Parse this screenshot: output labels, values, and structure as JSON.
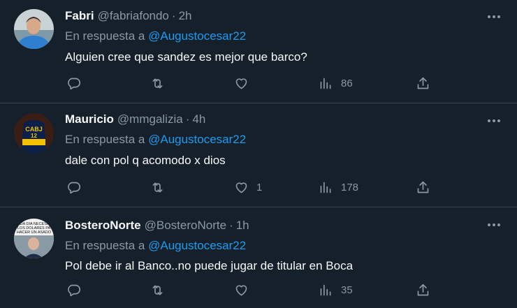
{
  "tweets": [
    {
      "name": "Fabri",
      "handle": "@fabriafondo",
      "separator": "·",
      "time": "2h",
      "reply_prefix": "En respuesta a",
      "reply_user": "@Augustocesar22",
      "text": "Alguien cree que sandez es mejor que barco?",
      "likes": "",
      "views": "86"
    },
    {
      "name": "Mauricio",
      "handle": "@mmgalizia",
      "separator": "·",
      "time": "4h",
      "reply_prefix": "En respuesta a",
      "reply_user": "@Augustocesar22",
      "text": "dale con pol q acomodo x dios",
      "likes": "1",
      "views": "178"
    },
    {
      "name": "BosteroNorte",
      "handle": "@BosteroNorte",
      "separator": "·",
      "time": "1h",
      "reply_prefix": "En respuesta a",
      "reply_user": "@Augustocesar22",
      "text": "Pol debe ir al Banco..no puede jugar de titular en Boca",
      "likes": "",
      "views": "35"
    }
  ],
  "avatar2_text": [
    "CABJ",
    "12"
  ],
  "avatar3_text": [
    "CADA DIA NECESITO",
    "LOS DOLARES PA",
    "HACER UN ASADO"
  ],
  "colors": {
    "background": "#15202b",
    "divider": "#38444d",
    "muted": "#8b98a5",
    "link": "#1d9bf0",
    "text": "#f7f9f9"
  },
  "icons": {
    "reply": "reply-icon",
    "retweet": "retweet-icon",
    "like": "heart-icon",
    "views": "views-chart-icon",
    "share": "share-icon",
    "more": "more-dots-icon"
  }
}
